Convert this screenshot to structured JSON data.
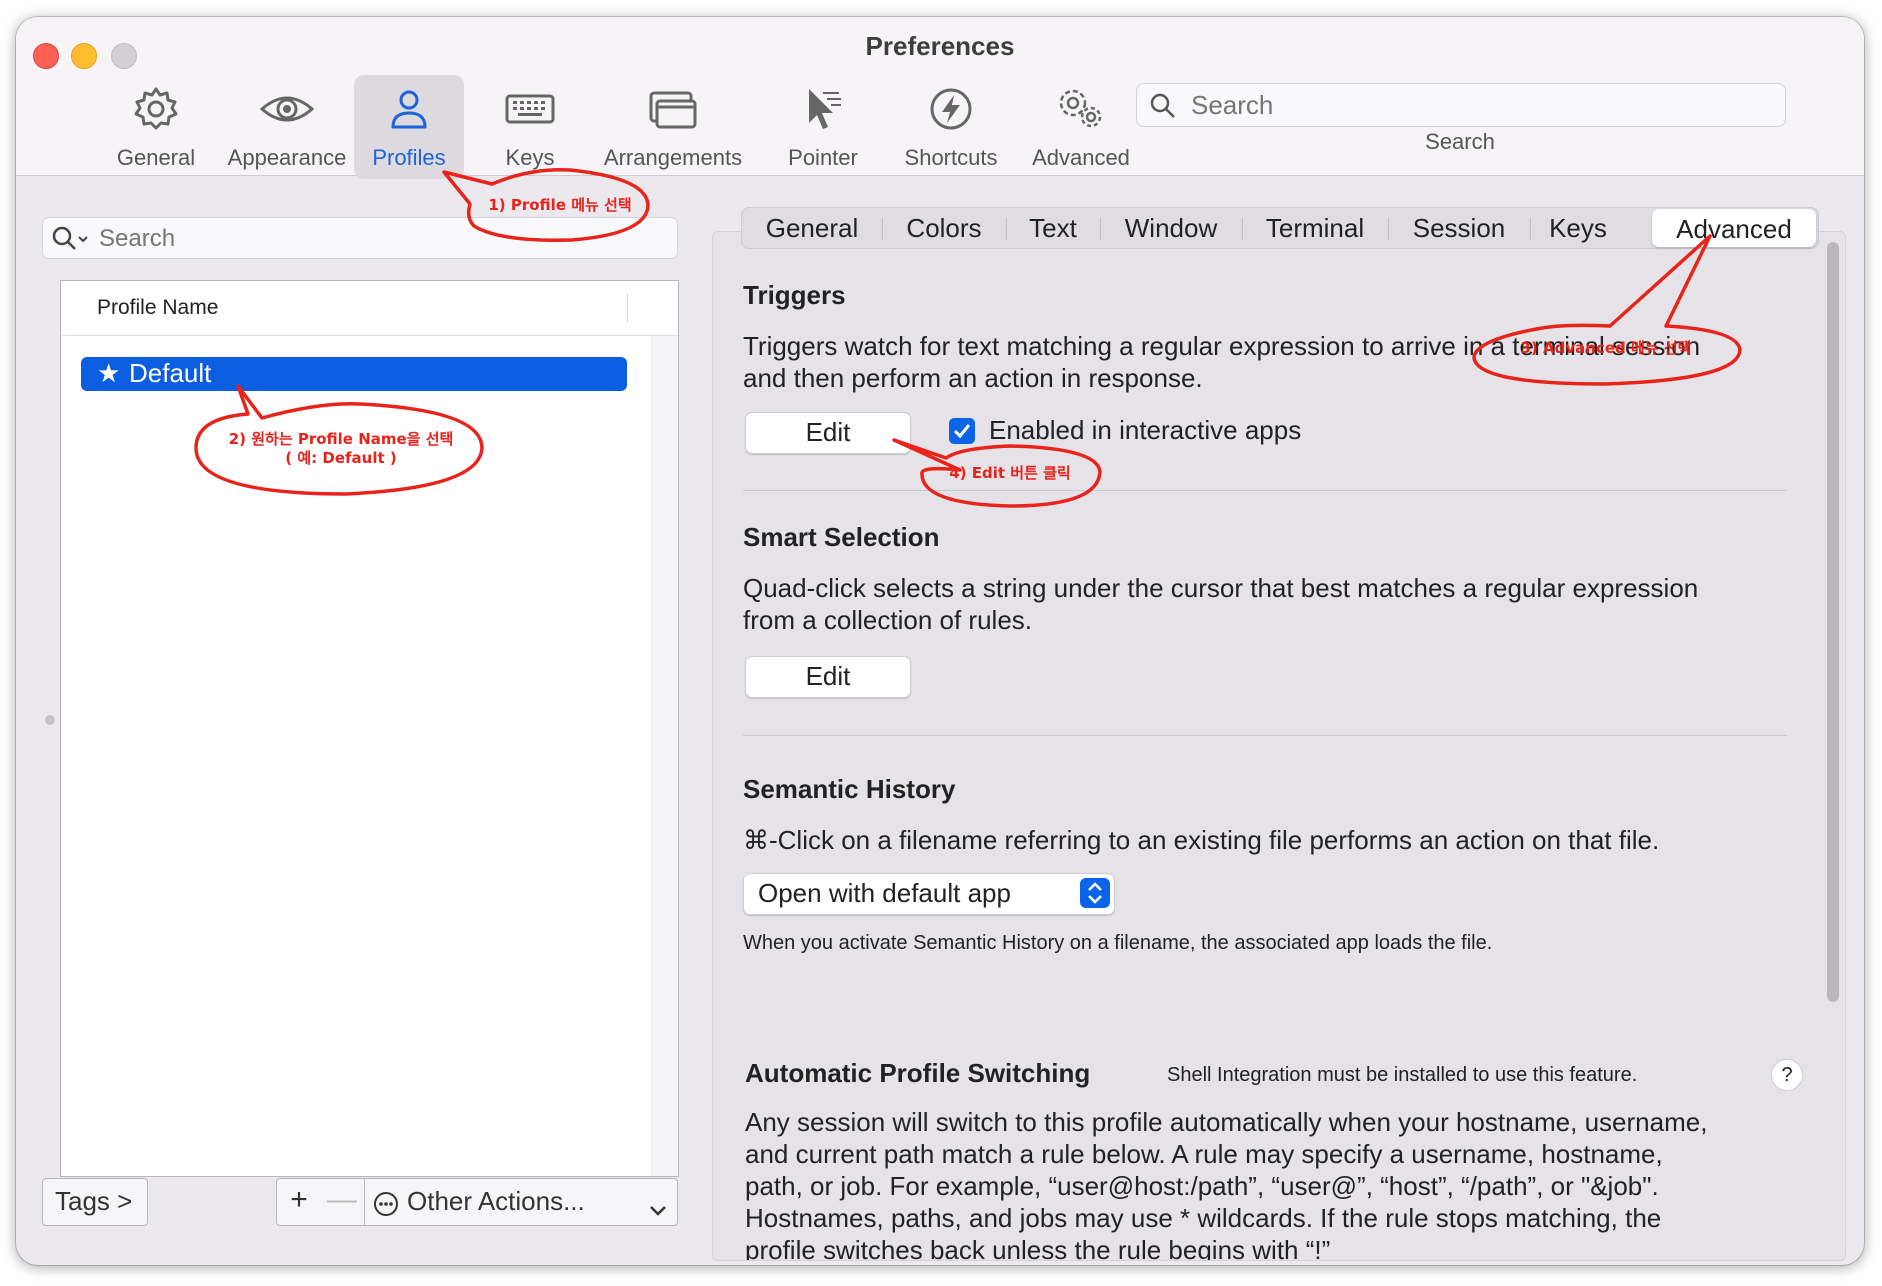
{
  "window": {
    "title": "Preferences"
  },
  "toolbar": {
    "items": [
      {
        "label": "General",
        "icon": "gear-icon"
      },
      {
        "label": "Appearance",
        "icon": "eye-icon"
      },
      {
        "label": "Profiles",
        "icon": "person-icon",
        "active": true
      },
      {
        "label": "Keys",
        "icon": "keyboard-icon"
      },
      {
        "label": "Arrangements",
        "icon": "windows-icon"
      },
      {
        "label": "Pointer",
        "icon": "pointer-icon"
      },
      {
        "label": "Shortcuts",
        "icon": "lightning-icon"
      },
      {
        "label": "Advanced",
        "icon": "gears-icon"
      }
    ],
    "search": {
      "placeholder": "Search",
      "caption": "Search"
    }
  },
  "profiles": {
    "search_placeholder": "Search",
    "column_header": "Profile Name",
    "items": [
      {
        "name": "Default",
        "default": true,
        "selected": true
      }
    ],
    "tags_button": "Tags >",
    "add_button": "+",
    "remove_button": "—",
    "other_actions": "Other Actions..."
  },
  "tabs": [
    "General",
    "Colors",
    "Text",
    "Window",
    "Terminal",
    "Session",
    "Keys",
    "Advanced"
  ],
  "active_tab": "Advanced",
  "triggers": {
    "title": "Triggers",
    "description_line1": "Triggers watch for text matching a regular expression to arrive in a terminal session",
    "description_line2": "and then perform an action in response.",
    "edit_button": "Edit",
    "checkbox_label": "Enabled in interactive apps",
    "checkbox_checked": true
  },
  "smart_selection": {
    "title": "Smart Selection",
    "description_line1": "Quad-click selects a string under the cursor that best matches a regular expression",
    "description_line2": "from a collection of rules.",
    "edit_button": "Edit"
  },
  "semantic_history": {
    "title": "Semantic History",
    "description": "⌘-Click on a filename referring to an existing file performs an action on that file.",
    "popup_value": "Open with default app",
    "note": "When you activate Semantic History on a filename, the associated app loads the file."
  },
  "auto_profile_switching": {
    "title": "Automatic Profile Switching",
    "note": "Shell Integration must be installed to use this feature.",
    "help": "?",
    "lines": [
      "Any session will switch to this profile automatically when your hostname, username,",
      "and current path match a rule below. A rule may specify a username, hostname,",
      "path, or job. For example, “user@host:/path”, “user@”, “host”, “/path”, or \"&job\".",
      "Hostnames, paths, and jobs may use * wildcards. If the rule stops matching, the",
      "profile switches back unless the rule begins with “!”"
    ]
  },
  "annotations": {
    "step1": "1) Profile 메뉴 선택",
    "step2_line1": "2) 원하는 Profile Name을 선택",
    "step2_line2": "( 예: Default )",
    "step3": "3) Advanced 메뉴 선택",
    "step4": "4) Edit 버튼 클릭",
    "color": "#e8231a"
  },
  "colors": {
    "accent": "#0b5ee0",
    "annotation": "#e8231a"
  }
}
